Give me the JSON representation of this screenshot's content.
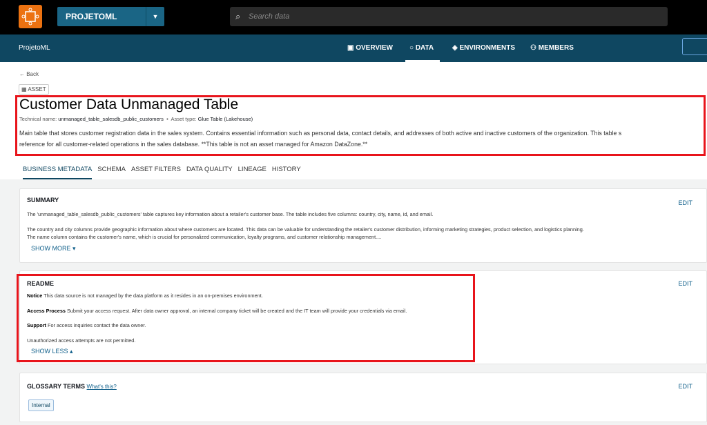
{
  "topbar": {
    "project": "PROJETOML",
    "search_placeholder": "Search data"
  },
  "nav": {
    "title": "ProjetoML",
    "items": [
      {
        "label": "OVERVIEW"
      },
      {
        "label": "DATA"
      },
      {
        "label": "ENVIRONMENTS"
      },
      {
        "label": "MEMBERS"
      }
    ]
  },
  "asset": {
    "back": "← Back",
    "badge": "ASSET",
    "title": "Customer Data Unmanaged Table",
    "technical_name_label": "Technical name:",
    "technical_name": "unmanaged_table_salesdb_public_customers",
    "asset_type_label": "Asset type:",
    "asset_type": "Glue Table (Lakehouse)",
    "description_1": "Main table that stores customer registration data in the sales system. Contains essential information such as personal data, contact details, and addresses of both active and inactive customers of the organization. This table s",
    "description_2": "reference for all customer-related operations in the sales database. **This table is not an asset managed for Amazon DataZone.**"
  },
  "tabs": [
    "BUSINESS METADATA",
    "SCHEMA",
    "ASSET FILTERS",
    "DATA QUALITY",
    "LINEAGE",
    "HISTORY"
  ],
  "summary": {
    "heading": "SUMMARY",
    "edit": "EDIT",
    "p1": "The 'unmanaged_table_salesdb_public_customers' table captures key information about a retailer's customer base. The table includes five columns: country, city, name, id, and email.",
    "p2": "The country and city columns provide geographic information about where customers are located. This data can be valuable for understanding the retailer's customer distribution, informing marketing strategies, product selection, and logistics planning.",
    "p3": "The name column contains the customer's name, which is crucial for personalized communication, loyalty programs, and customer relationship management....",
    "toggle": "SHOW MORE"
  },
  "readme": {
    "heading": "README",
    "edit": "EDIT",
    "notice_label": "Notice",
    "notice": " This data source is not managed by the data platform as it resides in an on-premises environment.",
    "access_label": "Access Process",
    "access": " Submit your access request. After data owner approval, an internal company ticket will be created and the IT team will provide your credentials via email.",
    "support_label": "Support",
    "support": " For access inquiries contact the data owner.",
    "warning": "Unauthorized access attempts are not permitted.",
    "toggle": "SHOW LESS"
  },
  "glossary": {
    "heading": "GLOSSARY TERMS",
    "help": "What's this?",
    "edit": "EDIT",
    "terms": [
      "Internal"
    ]
  }
}
